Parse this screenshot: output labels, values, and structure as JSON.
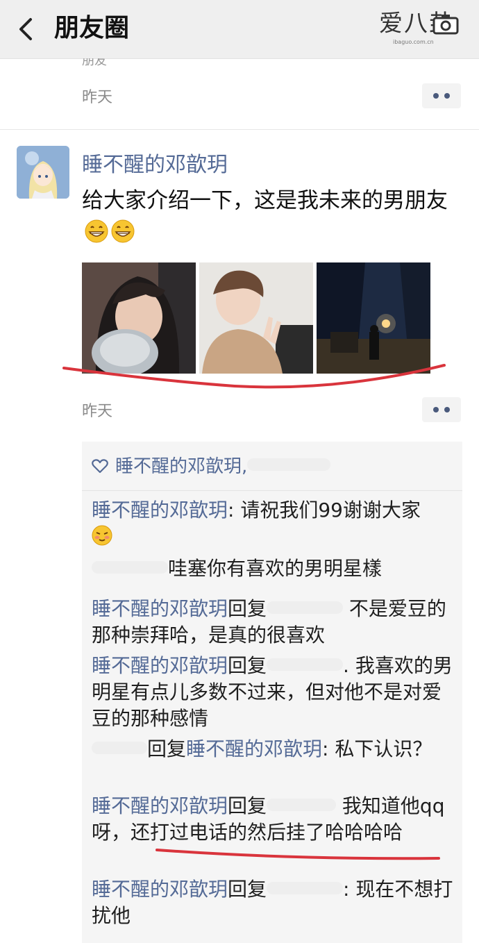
{
  "header": {
    "title": "朋友圈",
    "logo_text": "爱八卦",
    "logo_sub": "ibaguo.com.cn"
  },
  "prev_post": {
    "stub_text": "朋友",
    "time": "昨天"
  },
  "post": {
    "author": "睡不醒的邓歆玥",
    "text": "给大家介绍一下，这是我未来的男朋友",
    "time": "昨天",
    "emoji_count": 2
  },
  "likes": {
    "names": "睡不醒的邓歆玥,"
  },
  "comments": [
    {
      "name": "睡不醒的邓歆玥",
      "pre": "",
      "reply_to": "",
      "text": ": 请祝我们99谢谢大家"
    },
    {
      "name": "",
      "pre": "",
      "reply_to": "",
      "text": "哇塞你有喜欢的男明星樣"
    },
    {
      "name": "睡不醒的邓歆玥",
      "pre": "回复",
      "reply_to": "",
      "text": " 不是爱豆的那种崇拜哈，是真的很喜欢"
    },
    {
      "name": "睡不醒的邓歆玥",
      "pre": "回复",
      "reply_to": "",
      "text": ". 我喜欢的男明星有点儿多数不过来，但对他不是对爱豆的那种感情"
    },
    {
      "name": "",
      "pre": "回复",
      "reply_to": "睡不醒的邓歆玥",
      "text": ": 私下认识？"
    },
    {
      "name": "睡不醒的邓歆玥",
      "pre": "回复",
      "reply_to": "",
      "text": " 我知道他qq呀，还打过电话的然后挂了哈哈哈哈"
    },
    {
      "name": "睡不醒的邓歆玥",
      "pre": "回复",
      "reply_to": "",
      "text": ": 现在不想打扰他"
    }
  ],
  "colors": {
    "name_blue": "#546a96",
    "underline_red": "#d9343c",
    "header_bg": "#efefef"
  },
  "icons": [
    "chevron-left-icon",
    "more-dots-icon",
    "heart-icon",
    "grin-emoji-icon",
    "shy-emoji-icon",
    "camera-icon"
  ]
}
